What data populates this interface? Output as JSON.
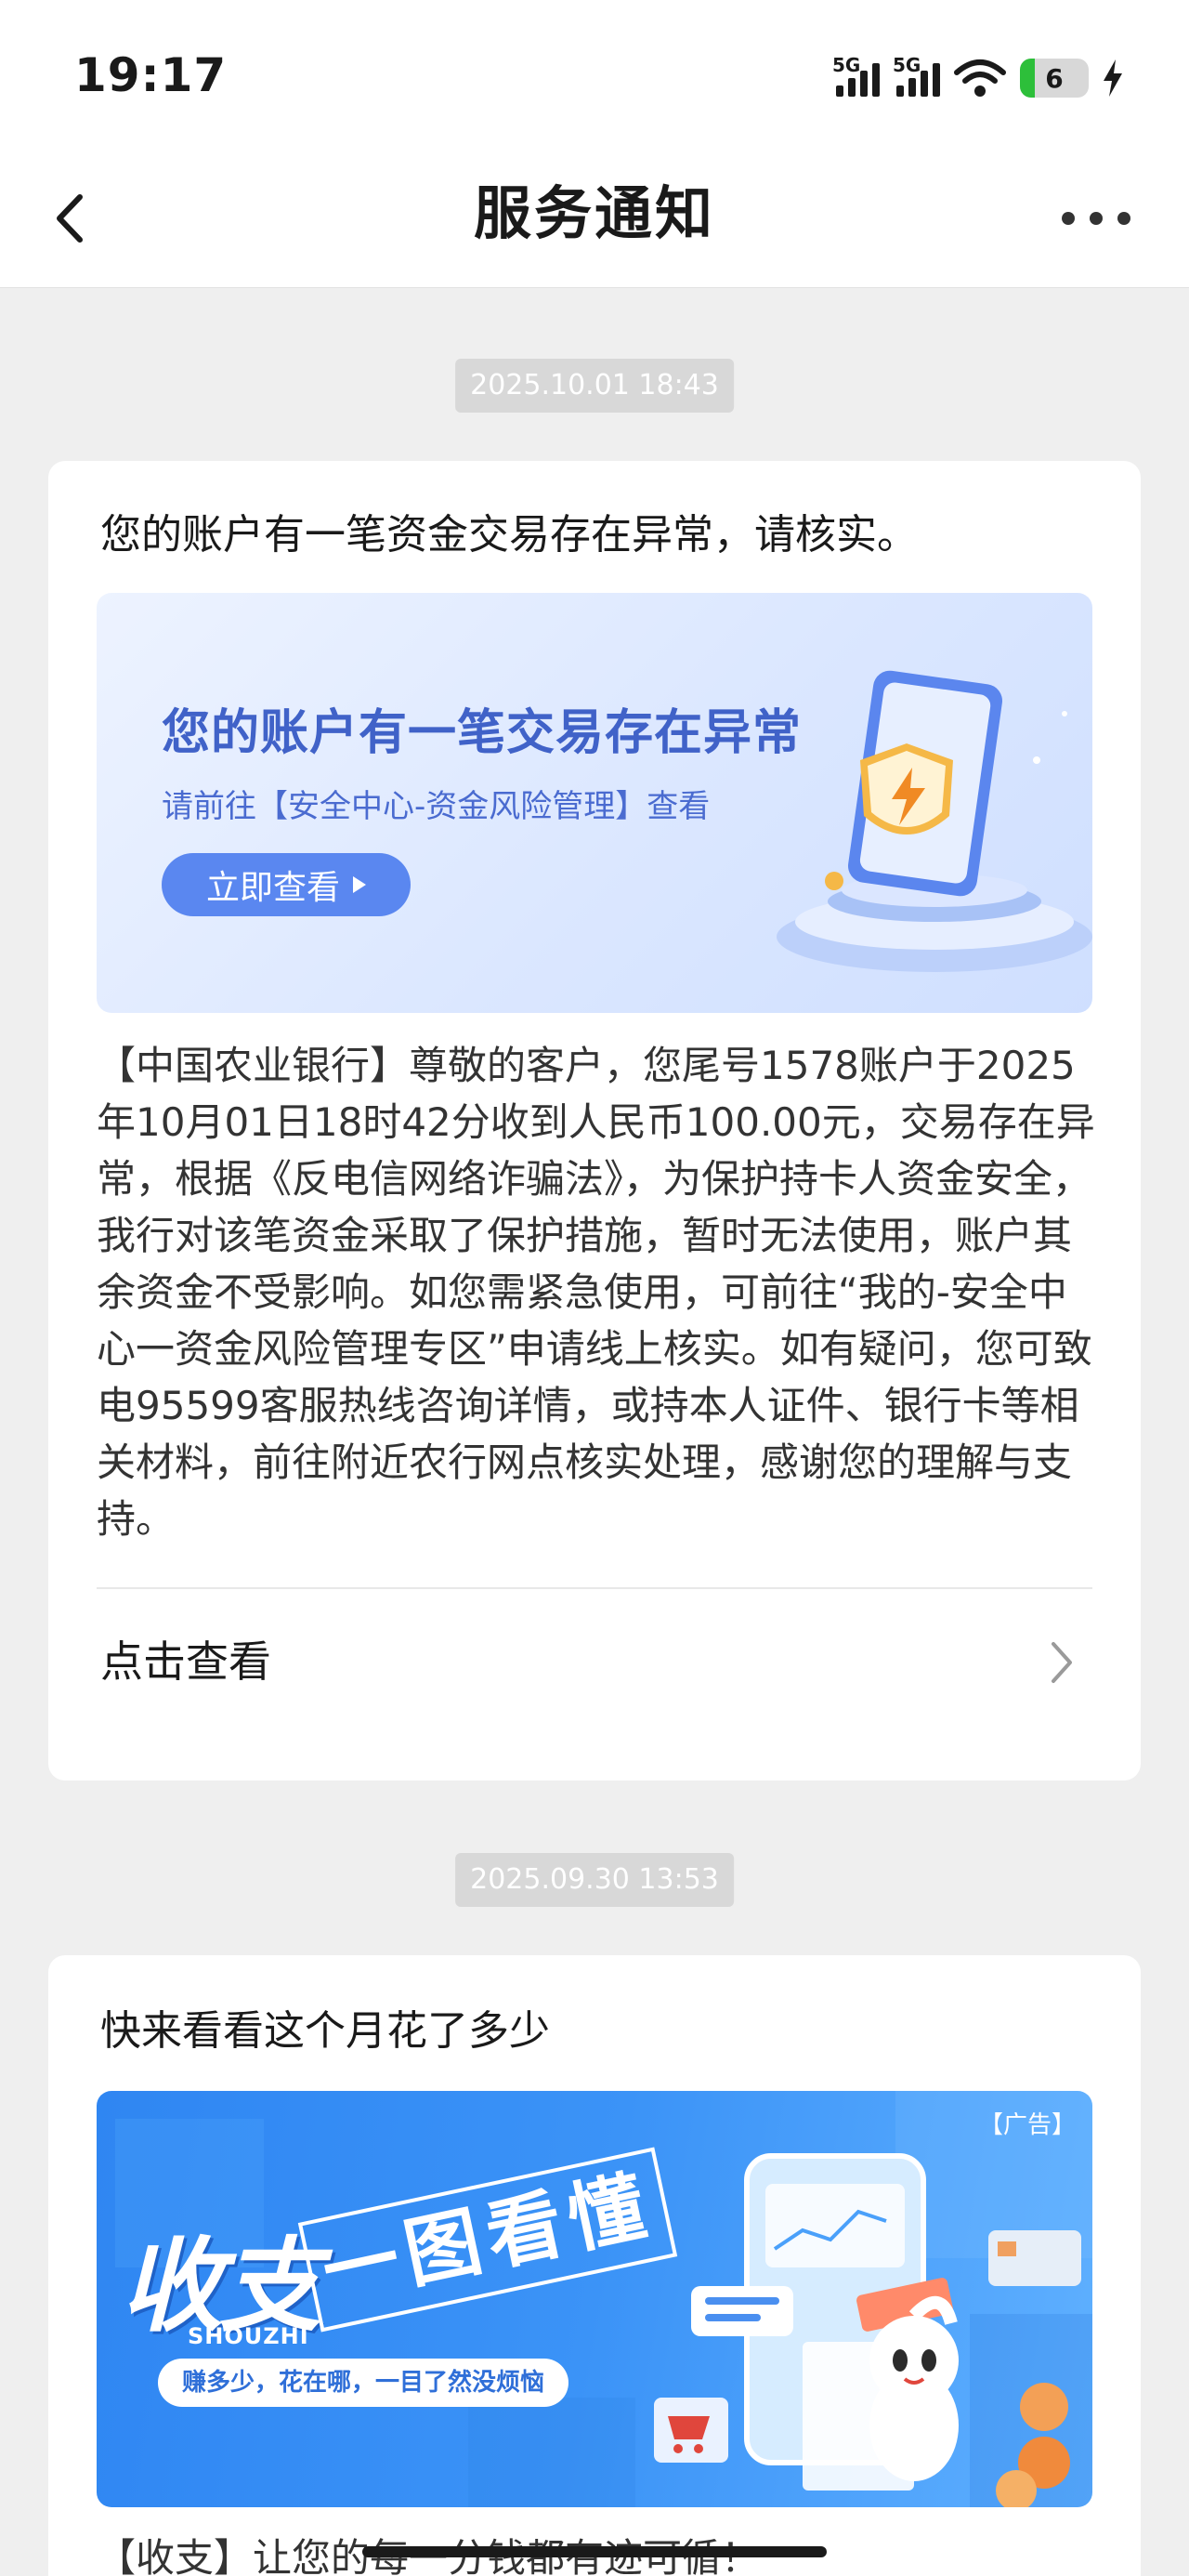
{
  "status_bar": {
    "time": "19:17",
    "network_1": "5G",
    "network_2": "5G",
    "battery_level": "6",
    "battery_percent": 6,
    "charging": true
  },
  "nav": {
    "title": "服务通知",
    "back_icon": "chevron-left-icon",
    "more_icon": "more-dots-icon"
  },
  "messages": [
    {
      "timestamp": "2025.10.01 18:43",
      "title": "您的账户有一笔资金交易存在异常，请核实。",
      "banner": {
        "headline": "您的账户有一笔交易存在异常",
        "subtitle": "请前往【安全中心-资金风险管理】查看",
        "button": "立即查看",
        "illustration": "phone-shield-lightning-icon"
      },
      "body": "【中国农业银行】尊敬的客户，您尾号1578账户于2025年10月01日18时42分收到人民币100.00元，交易存在异常，根据《反电信网络诈骗法》，为保护持卡人资金安全，我行对该笔资金采取了保护措施，暂时无法使用，账户其余资金不受影响。如您需紧急使用，可前往“我的-安全中心一资金风险管理专区”申请线上核实。如有疑问，您可致电95599客服热线咨询详情，或持本人证件、银行卡等相关材料，前往附近农行网点核实处理，感谢您的理解与支持。",
      "action": "点击查看"
    },
    {
      "timestamp": "2025.09.30 13:53",
      "title": "快来看看这个月花了多少",
      "banner": {
        "ad_label": "【广告】",
        "big_text": "收支",
        "pinyin": "SHOUZHI",
        "boxed_text": "一图看懂",
        "pill_text": "赚多少，花在哪，一目了然没烦恼",
        "illustration": "phone-mascot-coins-icon"
      },
      "body_peek": "【收支】让您的每一分钱都有迹可循！"
    }
  ],
  "colors": {
    "page_bg": "#efefef",
    "card_bg": "#ffffff",
    "timestamp_bg": "#d8d8d8",
    "banner1_accent": "#4062c8",
    "banner1_button": "#5a87f0",
    "banner2_bg": "#3b93f7"
  }
}
